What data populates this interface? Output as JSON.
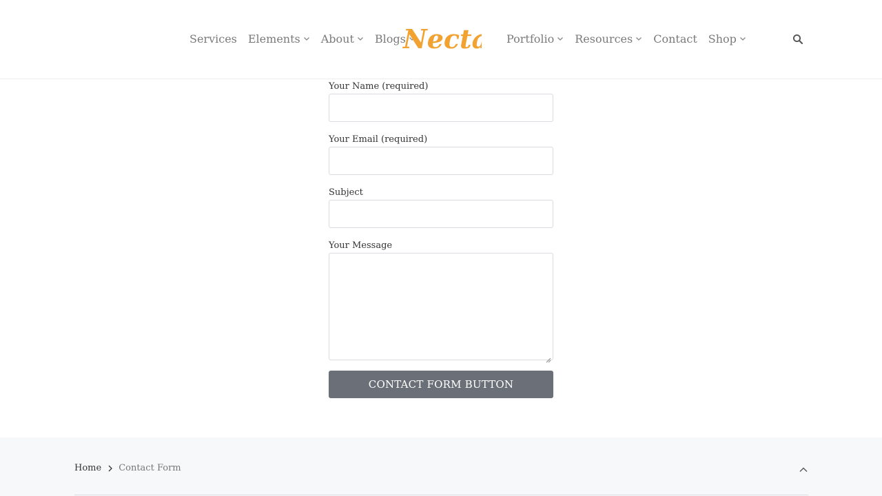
{
  "header": {
    "nav_left": [
      {
        "label": "Services",
        "has_dropdown": false
      },
      {
        "label": "Elements",
        "has_dropdown": true
      },
      {
        "label": "About",
        "has_dropdown": true
      },
      {
        "label": "Blogs",
        "has_dropdown": true
      }
    ],
    "logo_text": "Nectar",
    "nav_right": [
      {
        "label": "Portfolio",
        "has_dropdown": true
      },
      {
        "label": "Resources",
        "has_dropdown": true
      },
      {
        "label": "Contact",
        "has_dropdown": false
      },
      {
        "label": "Shop",
        "has_dropdown": true
      }
    ],
    "search_icon": "search-icon"
  },
  "form": {
    "name_label": "Your Name (required)",
    "name_value": "",
    "email_label": "Your Email (required)",
    "email_value": "",
    "subject_label": "Subject",
    "subject_value": "",
    "message_label": "Your Message",
    "message_value": "",
    "submit_label": "CONTACT FORM BUTTON"
  },
  "breadcrumb": {
    "home": "Home",
    "current": "Contact Form"
  },
  "colors": {
    "logo": "#f2a230",
    "button_bg": "#6b7078",
    "footer_bg": "#f7f8fa"
  }
}
